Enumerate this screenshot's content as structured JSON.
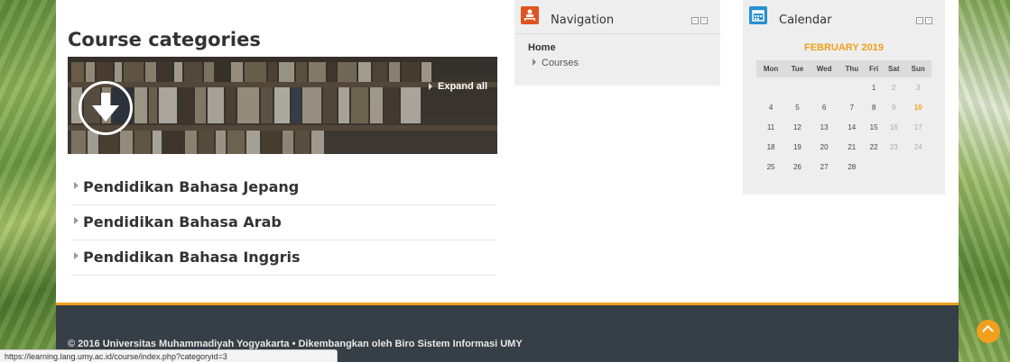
{
  "page": {
    "title": "Course categories",
    "expand_all": "Expand all"
  },
  "categories": [
    {
      "label": "Pendidikan Bahasa Jepang"
    },
    {
      "label": "Pendidikan Bahasa Arab"
    },
    {
      "label": "Pendidikan Bahasa Inggris"
    }
  ],
  "navigation": {
    "title": "Navigation",
    "home": "Home",
    "courses": "Courses"
  },
  "calendar": {
    "title": "Calendar",
    "month": "FEBRUARY 2019",
    "days": [
      "Mon",
      "Tue",
      "Wed",
      "Thu",
      "Fri",
      "Sat",
      "Sun"
    ],
    "weeks": [
      [
        "",
        "",
        "",
        "",
        "1",
        "2",
        "3"
      ],
      [
        "4",
        "5",
        "6",
        "7",
        "8",
        "9",
        "10"
      ],
      [
        "11",
        "12",
        "13",
        "14",
        "15",
        "16",
        "17"
      ],
      [
        "18",
        "19",
        "20",
        "21",
        "22",
        "23",
        "24"
      ],
      [
        "25",
        "26",
        "27",
        "28",
        "",
        "",
        ""
      ]
    ],
    "today": "10"
  },
  "footer": {
    "text": "© 2016 Universitas Muhammadiyah Yogyakarta • Dikembangkan oleh Biro Sistem Informasi UMY"
  },
  "status_bar": {
    "url": "https://learning.lang.umy.ac.id/course/index.php?categoryid=3"
  },
  "colors": {
    "accent": "#f0a01c",
    "nav_icon": "#e2531f",
    "calendar_icon": "#2a8fd0",
    "footer": "#363e46"
  },
  "icons": {
    "download": "download-arrow-icon",
    "navigation": "sitemap-icon",
    "calendar": "calendar-icon",
    "scroll_top": "chevron-up-icon"
  }
}
